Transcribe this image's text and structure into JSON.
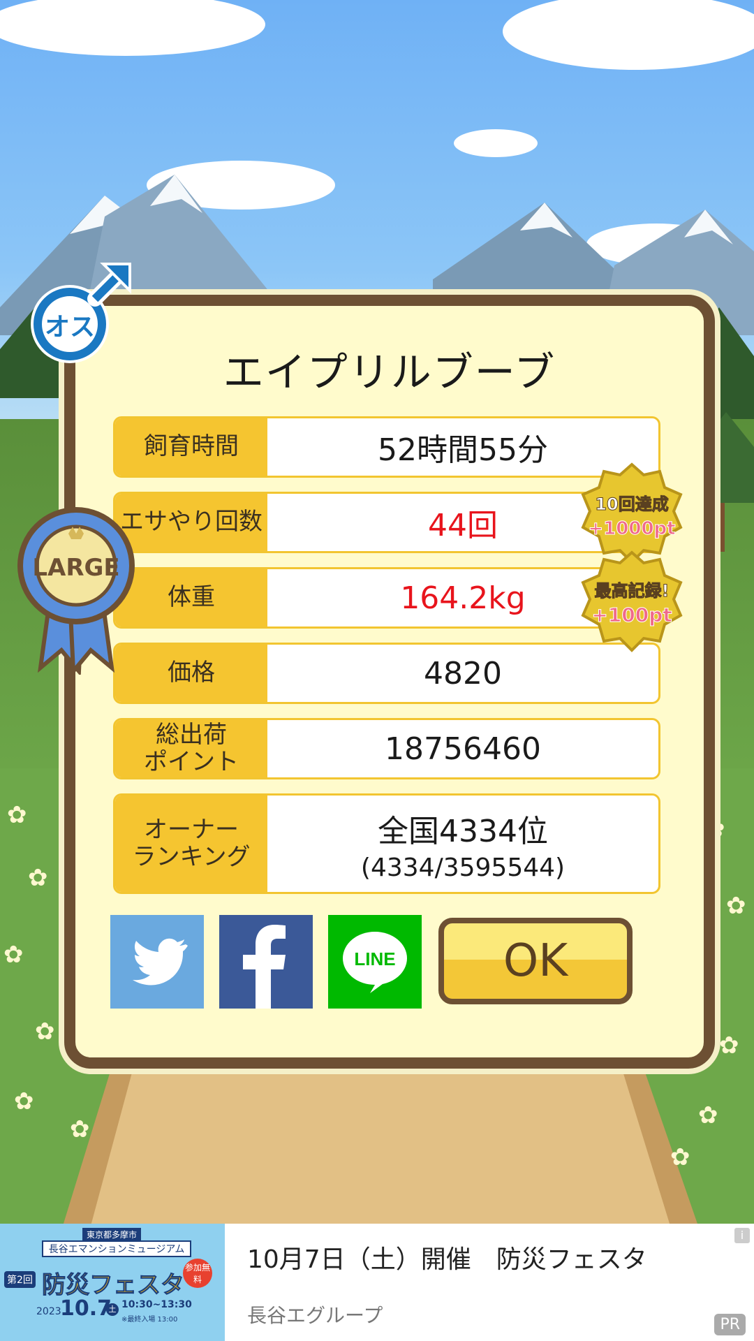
{
  "dialog": {
    "title": "エイプリルブーブ",
    "rows": [
      {
        "label": "飼育時間",
        "value": "52時間55分"
      },
      {
        "label": "エサやり回数",
        "value": "44回"
      },
      {
        "label": "体重",
        "value": "164.2kg"
      },
      {
        "label": "価格",
        "value": "4820"
      },
      {
        "label": "総出荷\nポイント",
        "value": "18756460"
      },
      {
        "label": "オーナー\nランキング",
        "value": "全国4334位",
        "value_sub": "(4334/3595544)"
      }
    ],
    "ok_label": "OK",
    "sns": {
      "line_label": "LINE"
    }
  },
  "badges": {
    "gender": "オス",
    "size": "LARGE",
    "medal1_line1": "10回達成",
    "medal1_line2": "+1000pt",
    "medal2_line1": "最高記録!",
    "medal2_line2": "+100pt"
  },
  "ad": {
    "title": "10月7日（土）開催　防災フェスタ",
    "advertiser": "長谷エグループ",
    "pr_label": "PR",
    "info_label": "i",
    "image": {
      "org": "東京都多摩市",
      "venue": "長谷エマンションミュージアム",
      "count": "第2回",
      "event": "防災フェスタ",
      "tag": "参加無料",
      "year": "2023",
      "date": "10.7",
      "day": "土",
      "time": "10:30~13:30",
      "note": "※最終入場 13:00"
    }
  },
  "colors": {
    "accent_red": "#e8141c",
    "label_yellow": "#f5c530",
    "frame_brown": "#6d5033"
  }
}
